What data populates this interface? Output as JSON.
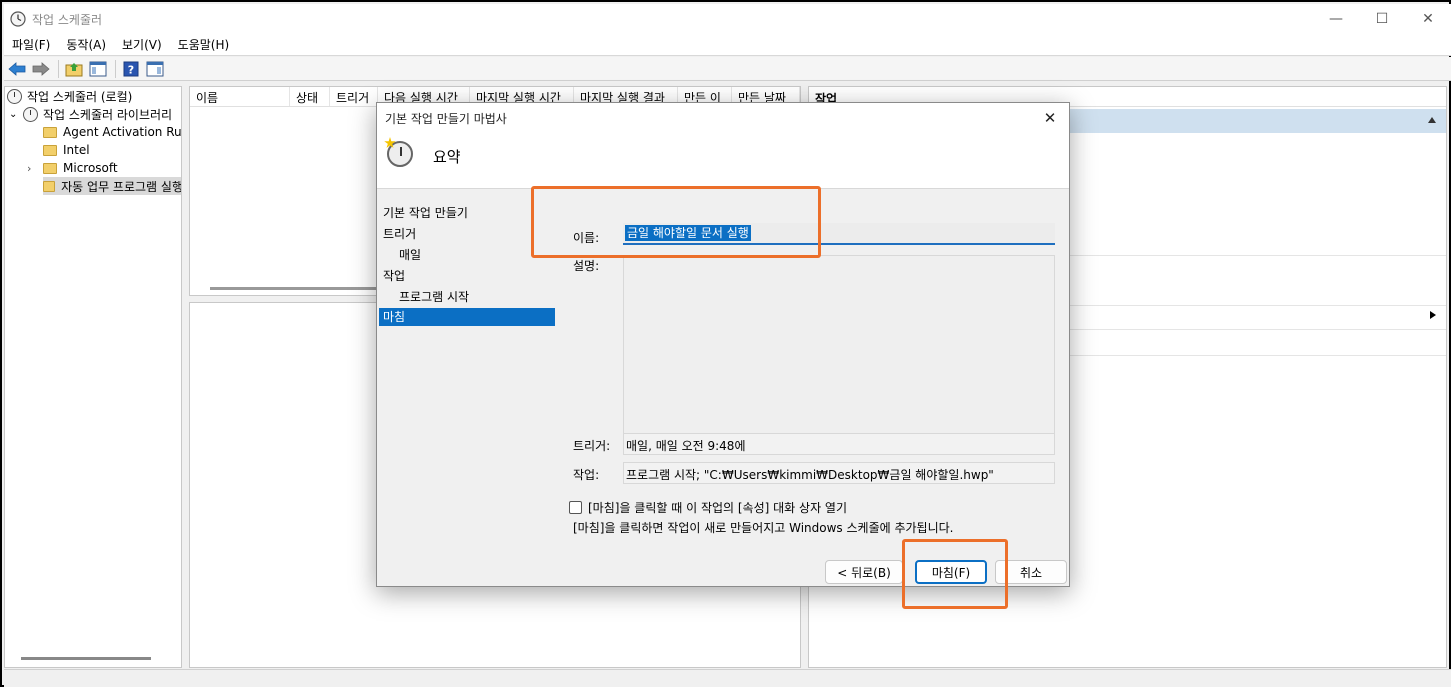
{
  "window": {
    "title": "작업 스케줄러",
    "controls": {
      "minimize": "—",
      "maximize": "☐",
      "close": "✕"
    }
  },
  "menu": [
    "파일(F)",
    "동작(A)",
    "보기(V)",
    "도움말(H)"
  ],
  "toolbar_icons": [
    "back-arrow-icon",
    "forward-arrow-icon",
    "folder-up-icon",
    "show-hide-tree-icon",
    "help-icon",
    "show-hide-actions-icon"
  ],
  "tree": {
    "root": "작업 스케줄러 (로컬)",
    "library": "작업 스케줄러 라이브러리",
    "items": [
      "Agent Activation Runtime",
      "Intel",
      "Microsoft",
      "자동 업무 프로그램 실행"
    ]
  },
  "columns": [
    "이름",
    "상태",
    "트리거",
    "다음 실행 시간",
    "마지막 실행 시간",
    "마지막 실행 결과",
    "만든 이",
    "만든 날짜"
  ],
  "actions": {
    "header": "작업"
  },
  "dialog": {
    "title": "기본 작업 만들기 마법사",
    "close": "✕",
    "page_title": "요약",
    "steps": [
      "기본 작업 만들기",
      "트리거",
      "매일",
      "작업",
      "프로그램 시작",
      "마침"
    ],
    "name_label": "이름:",
    "name_value": "금일 해야할일 문서 실행",
    "desc_label": "설명:",
    "trigger_label": "트리거:",
    "trigger_value": "매일, 매일 오전 9:48에",
    "action_label": "작업:",
    "action_value": "프로그램 시작; \"C:₩Users₩kimmi₩Desktop₩금일 해야할일.hwp\"",
    "checkbox_label": "[마침]을 클릭할 때 이 작업의 [속성] 대화 상자 열기",
    "note": "[마침]을 클릭하면 작업이 새로 만들어지고 Windows 스케줄에 추가됩니다.",
    "back_button": "< 뒤로(B)",
    "finish_button": "마침(F)",
    "cancel_button": "취소"
  },
  "colors": {
    "accent": "#0b6fc4",
    "highlight": "#ec6f2a",
    "actions_bar": "#cfe0ef"
  }
}
